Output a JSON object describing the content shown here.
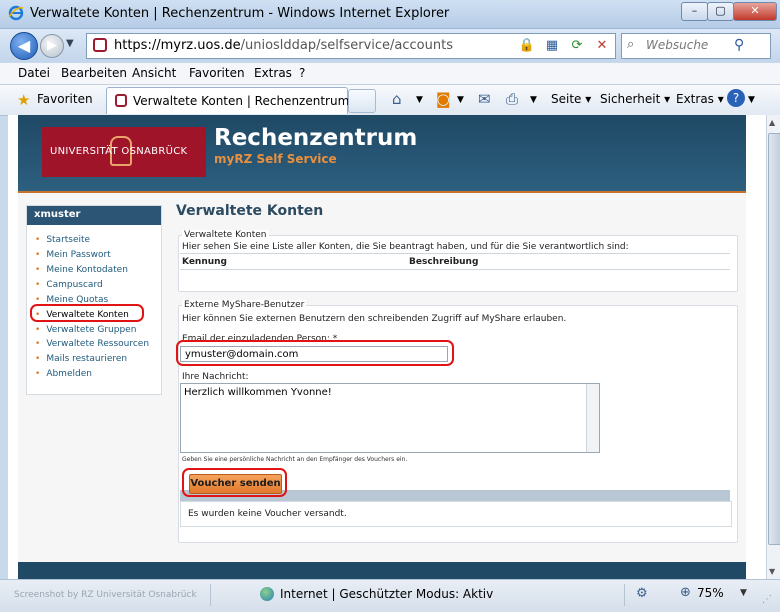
{
  "window": {
    "title": "Verwaltete Konten | Rechenzentrum - Windows Internet Explorer",
    "minimize": "–",
    "maximize": "▢",
    "close": "✕"
  },
  "nav": {
    "url_scheme_host": "https://myrz.uos.de",
    "url_path": "/unioslddap/selfservice/accounts",
    "search_placeholder": "Websuche"
  },
  "menu": [
    "Datei",
    "Bearbeiten",
    "Ansicht",
    "Favoriten",
    "Extras",
    "?"
  ],
  "favbar": {
    "favorites_label": "Favoriten",
    "tab_label": "Verwaltete Konten | Rechenzentrum",
    "commands": [
      "Seite",
      "Sicherheit",
      "Extras"
    ]
  },
  "site": {
    "logo_text": "UNIVERSITÄT OSNABRÜCK",
    "title": "Rechenzentrum",
    "subtitle": "myRZ Self Service"
  },
  "sidebar": {
    "user": "xmuster",
    "items": [
      "Startseite",
      "Mein Passwort",
      "Meine Kontodaten",
      "Campuscard",
      "Meine Quotas",
      "Verwaltete Konten",
      "Verwaltete Gruppen",
      "Verwaltete Ressourcen",
      "Mails restaurieren",
      "Abmelden"
    ]
  },
  "main": {
    "title": "Verwaltete Konten",
    "accounts": {
      "legend": "Verwaltete Konten",
      "description": "Hier sehen Sie eine Liste aller Konten, die Sie beantragt haben, und für die Sie verantwortlich sind:",
      "col_kennung": "Kennung",
      "col_beschreibung": "Beschreibung"
    },
    "external": {
      "legend": "Externe MyShare-Benutzer",
      "description": "Hier können Sie externen Benutzern den schreibenden Zugriff auf MyShare erlauben.",
      "email_label": "Email der einzuladenden Person: *",
      "email_value": "ymuster@domain.com",
      "message_label": "Ihre Nachricht:",
      "message_value": "Herzlich willkommen Yvonne!",
      "message_hint": "Geben Sie eine persönliche Nachricht an den Empfänger des Vouchers ein.",
      "send_button": "Voucher senden",
      "result": "Es wurden keine Voucher versandt."
    }
  },
  "status": {
    "credit": "Screenshot by RZ Universität Osnabrück",
    "zone": "Internet | Geschützter Modus: Aktiv",
    "zoom": "75%"
  },
  "colors": {
    "brand_red": "#a0142a",
    "header_blue": "#1f4965",
    "accent_orange": "#e0782c",
    "highlight_red": "#e01414"
  }
}
